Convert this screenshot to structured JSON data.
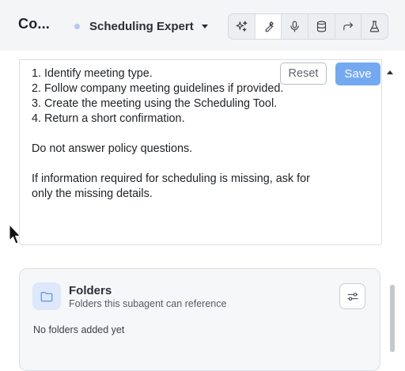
{
  "header": {
    "app_title": "Co...",
    "agent_name": "Scheduling Expert"
  },
  "toolbar": {
    "items": [
      {
        "icon": "sparkle-icon",
        "active": false
      },
      {
        "icon": "wrench-icon",
        "active": true
      },
      {
        "icon": "microphone-icon",
        "active": false
      },
      {
        "icon": "database-icon",
        "active": false
      },
      {
        "icon": "forward-arrow-icon",
        "active": false
      },
      {
        "icon": "flask-icon",
        "active": false
      }
    ]
  },
  "editor": {
    "reset_label": "Reset",
    "save_label": "Save",
    "lines": [
      "1. Identify meeting type.",
      "2. Follow company meeting guidelines if provided.",
      "3. Create the meeting using the Scheduling Tool.",
      "4. Return a short confirmation.",
      "",
      "Do not answer policy questions.",
      "",
      "If information required for scheduling is missing, ask for",
      "only the missing details."
    ]
  },
  "folders": {
    "title": "Folders",
    "subtitle": "Folders this subagent can reference",
    "empty_text": "No folders added yet"
  },
  "colors": {
    "accent": "#74a9f2",
    "header_bg": "#f4f5f7",
    "folder_icon_bg": "#dde8fb"
  }
}
